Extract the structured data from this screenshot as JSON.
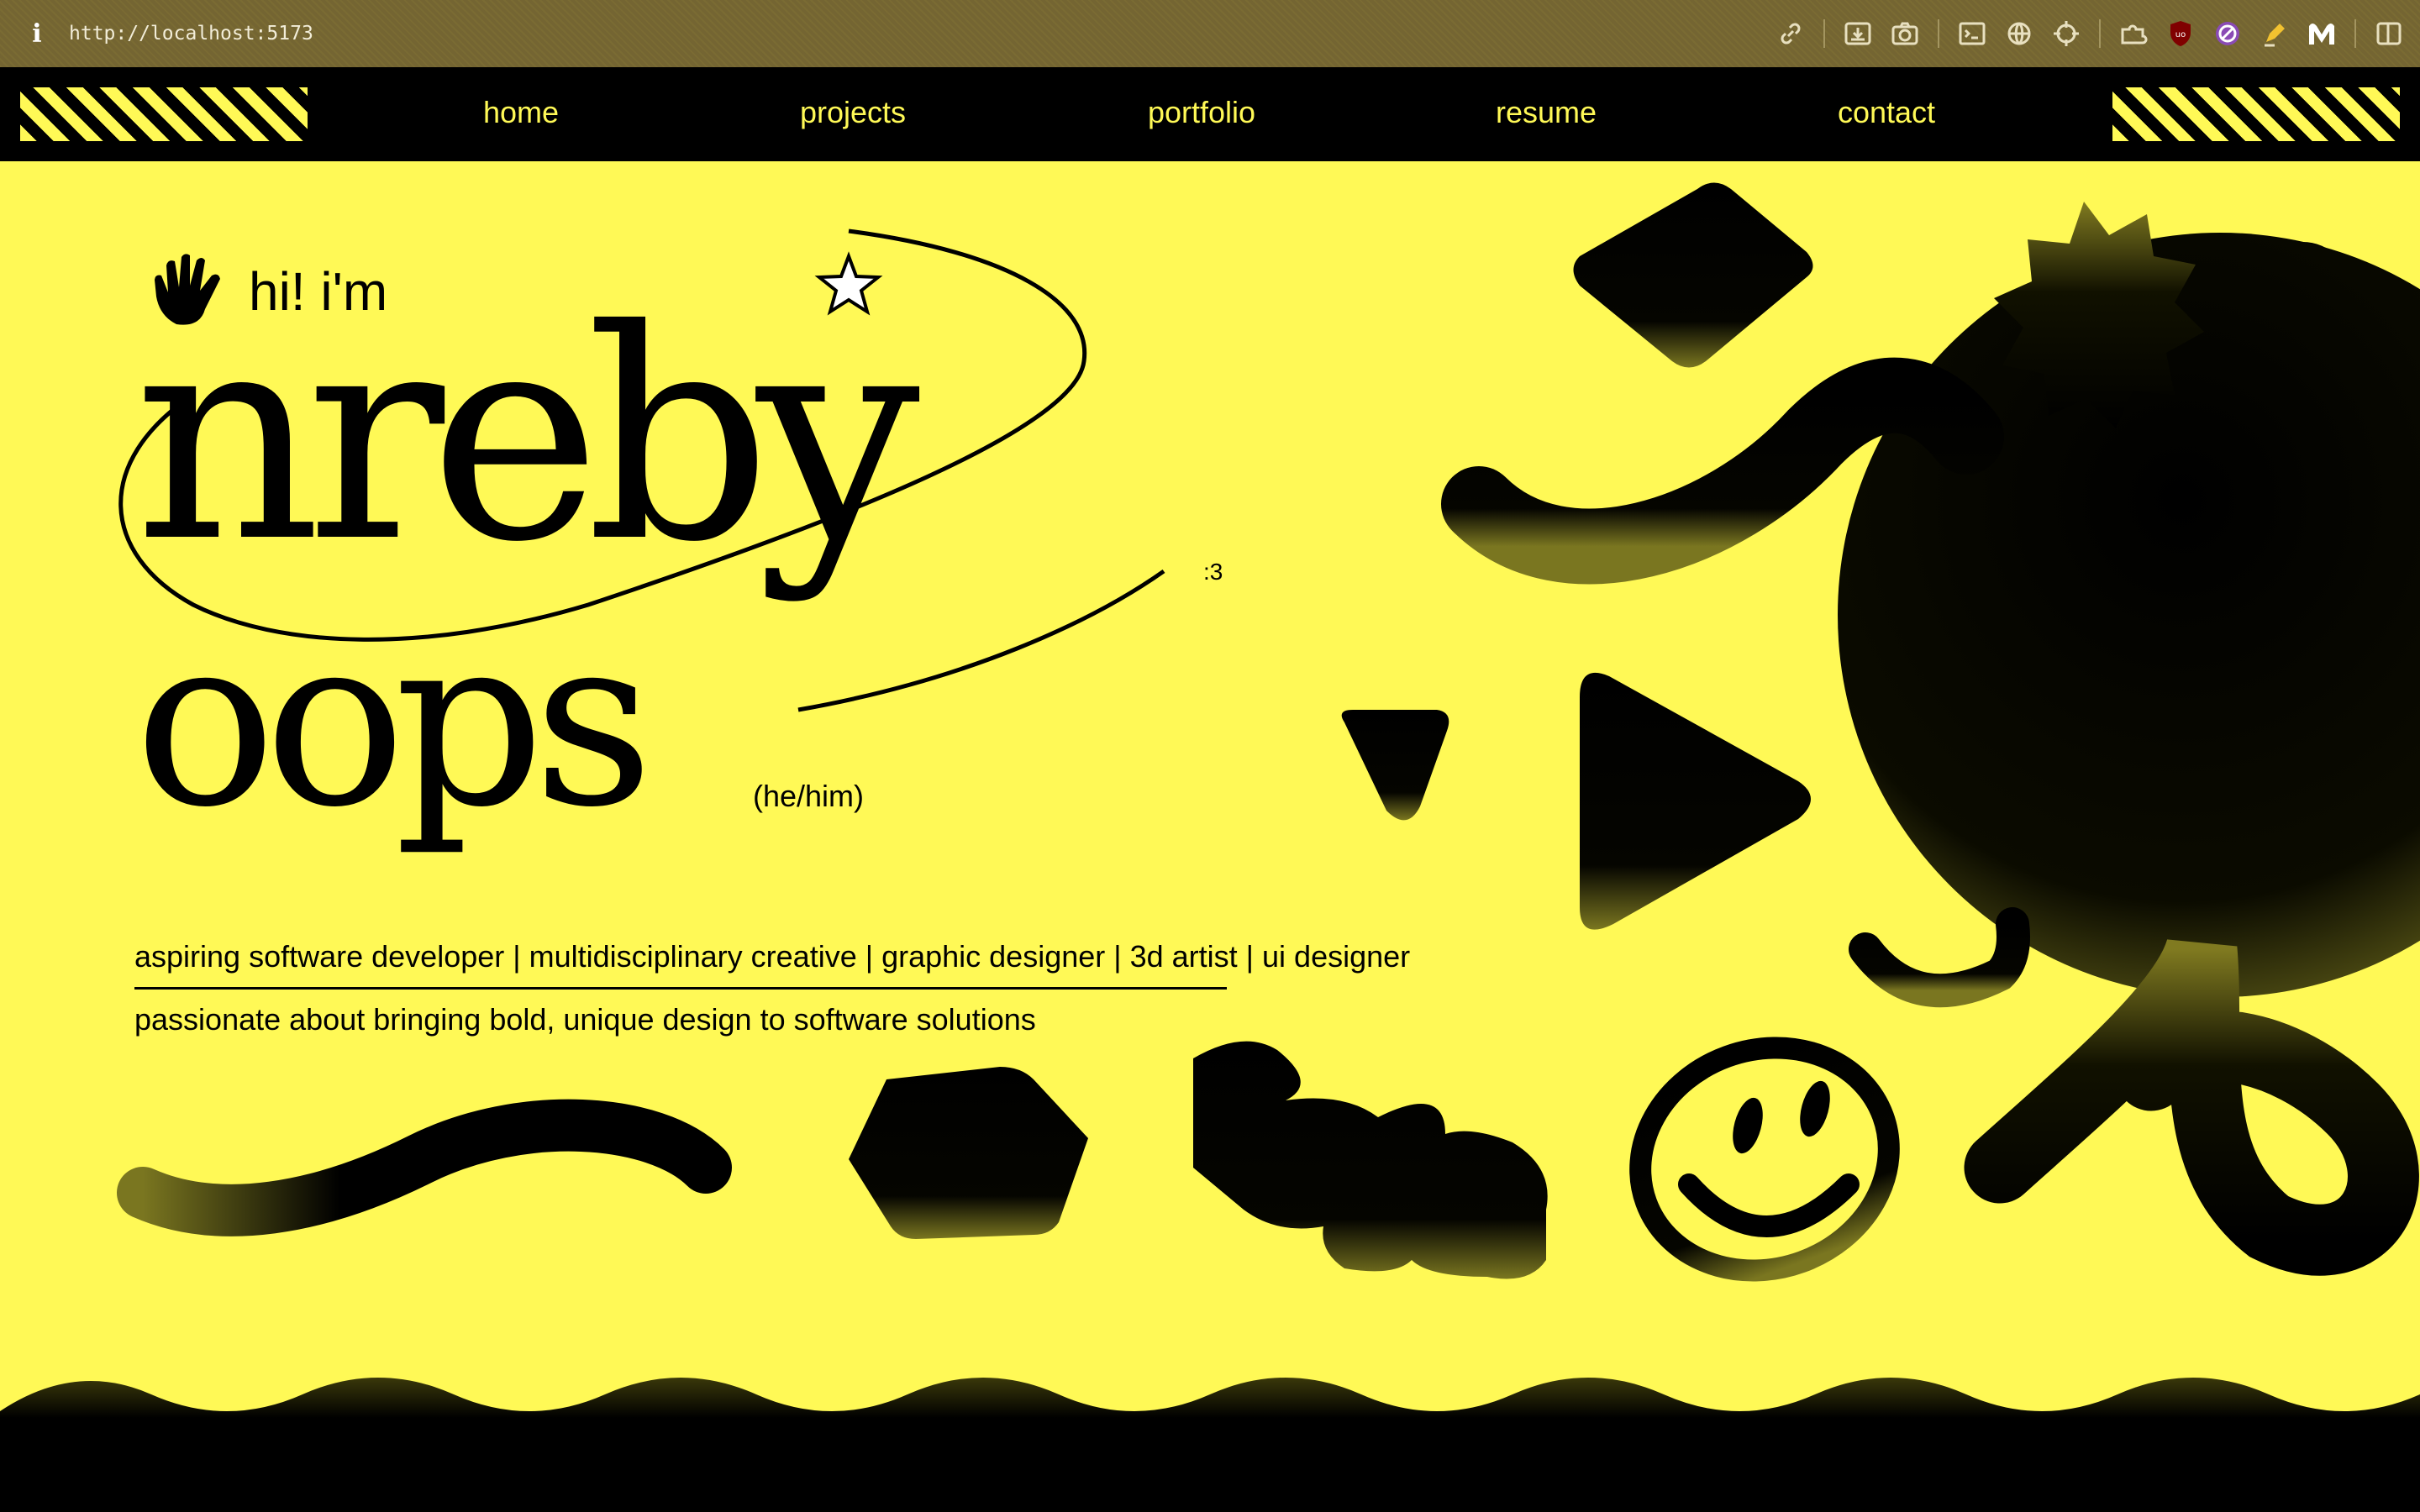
{
  "browser": {
    "info_icon": "i",
    "url": "http://localhost:5173",
    "toolbar_icons": [
      "link-icon",
      "download-icon",
      "camera-icon",
      "terminal-icon",
      "globe-icon",
      "crosshair-icon",
      "extensions-icon",
      "ublock-icon",
      "block-icon",
      "highlighter-icon",
      "m-logo-icon",
      "sidebar-icon"
    ]
  },
  "nav": {
    "links": [
      "home",
      "projects",
      "portfolio",
      "resume",
      "contact"
    ]
  },
  "hero": {
    "greeting": "hi! i'm",
    "first_name": "nreby",
    "last_name": "oops",
    "face": ":3",
    "pronouns": "(he/him)",
    "roles": "aspiring software developer | multidisciplinary creative | graphic designer | 3d artist | ui designer",
    "tagline": "passionate about bringing bold, unique design to software solutions"
  },
  "colors": {
    "accent": "#fff956",
    "ink": "#000000",
    "browser_bar": "#776834"
  }
}
